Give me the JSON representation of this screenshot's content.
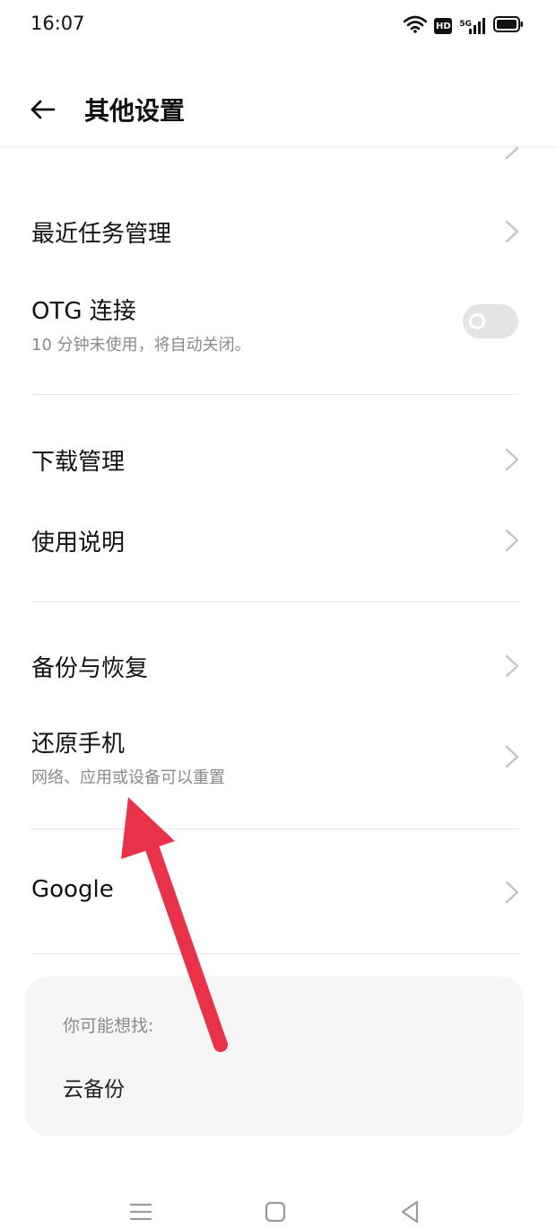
{
  "status_bar": {
    "time": "16:07",
    "hd_label": "HD",
    "network_label": "5G",
    "icons": [
      "wifi-icon",
      "hd-icon",
      "signal-5g-icon",
      "battery-icon"
    ]
  },
  "header": {
    "title": "其他设置",
    "back_icon": "arrow-left-icon"
  },
  "rows": {
    "recent_tasks": {
      "title": "最近任务管理"
    },
    "otg": {
      "title": "OTG 连接",
      "subtitle": "10 分钟未使用，将自动关闭。",
      "enabled": false
    },
    "downloads": {
      "title": "下载管理"
    },
    "manual": {
      "title": "使用说明"
    },
    "backup": {
      "title": "备份与恢复"
    },
    "reset": {
      "title": "还原手机",
      "subtitle": "网络、应用或设备可以重置"
    },
    "google": {
      "title": "Google"
    }
  },
  "suggestions": {
    "label": "你可能想找:",
    "items": [
      "云备份"
    ]
  },
  "nav_bar": {
    "icons": [
      "menu-icon",
      "home-icon",
      "back-triangle-icon"
    ]
  },
  "colors": {
    "annotation_arrow": "#e8324a",
    "toggle_off": "#e4e4e4",
    "subtitle": "#8a8a8a"
  }
}
